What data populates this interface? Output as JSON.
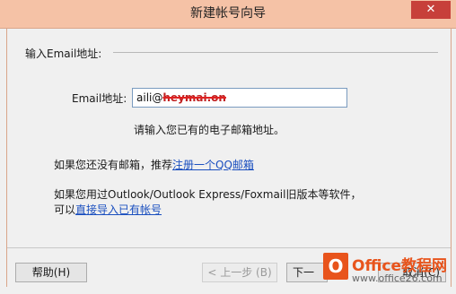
{
  "window": {
    "title": "新建帐号向导",
    "close_glyph": "✕"
  },
  "section": {
    "label": "输入Email地址:"
  },
  "email": {
    "label": "Email地址:",
    "value_user": "aili@",
    "value_domain": "heymai.on",
    "hint": "请输入您已有的电子邮箱地址。"
  },
  "no_mailbox": {
    "text": "如果您还没有邮箱，推荐",
    "link": "注册一个QQ邮箱"
  },
  "import": {
    "line1": "如果您用过Outlook/Outlook Express/Foxmail旧版本等软件，",
    "line2_prefix": "可以",
    "line2_link": "直接导入已有帐号"
  },
  "buttons": {
    "help": "帮助(H)",
    "prev": "< 上一步 (B)",
    "next": "下一",
    "cancel": "取消(C)"
  },
  "watermark": {
    "icon_letter": "O",
    "name": "Office教程网",
    "url": "www.office26.com"
  },
  "colors": {
    "titlebar": "#f5c2a6",
    "link": "#1a4fbf",
    "accent": "#e8541c"
  }
}
